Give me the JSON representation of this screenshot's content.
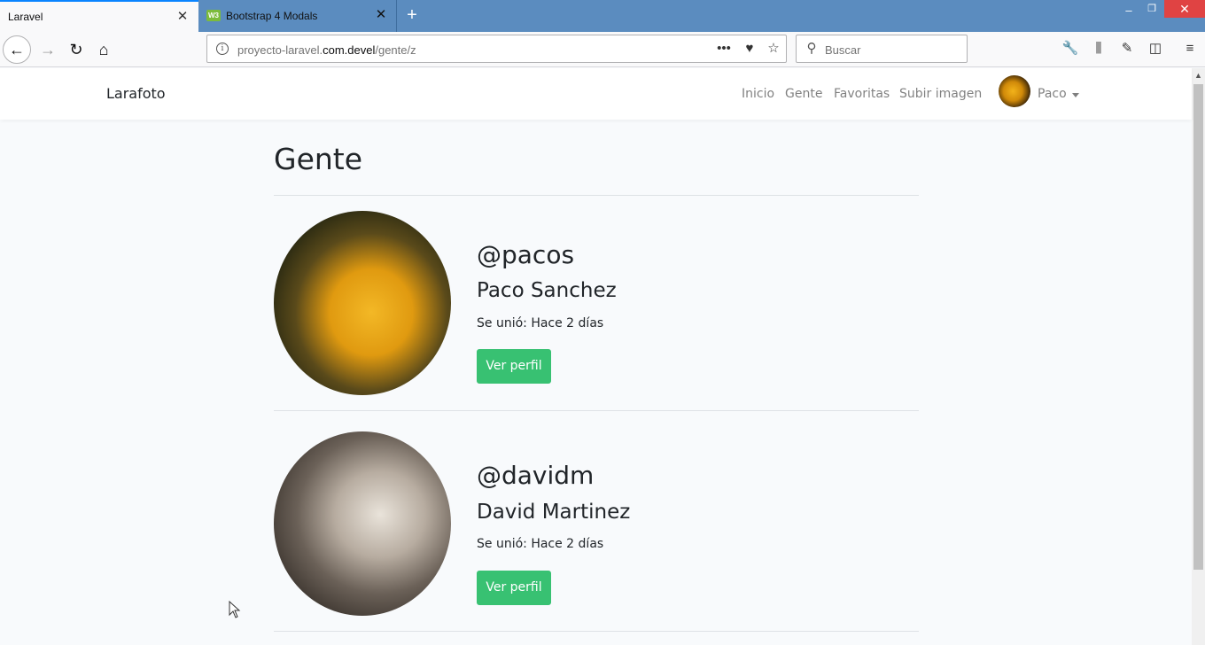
{
  "browser": {
    "tabs": [
      {
        "label": "Laravel",
        "active": true
      },
      {
        "label": "Bootstrap 4 Modals",
        "active": false,
        "favicon_text": "W3"
      }
    ],
    "url": {
      "prefix": "proyecto-laravel.",
      "domain": "com.devel",
      "path": "/gente/z"
    },
    "search_placeholder": "Buscar"
  },
  "navbar": {
    "brand": "Larafoto",
    "links": [
      "Inicio",
      "Gente",
      "Favoritas",
      "Subir imagen"
    ],
    "user": "Paco"
  },
  "page": {
    "title": "Gente",
    "users": [
      {
        "nick": "@pacos",
        "name": "Paco Sanchez",
        "joined": "Se unió: Hace 2 días",
        "button": "Ver perfil",
        "image": "seahorse"
      },
      {
        "nick": "@davidm",
        "name": "David Martinez",
        "joined": "Se unió: Hace 2 días",
        "button": "Ver perfil",
        "image": "kitten"
      }
    ]
  },
  "colors": {
    "accent": "#0a84ff",
    "success": "#38c172",
    "tabbar": "#5b8cbf"
  }
}
